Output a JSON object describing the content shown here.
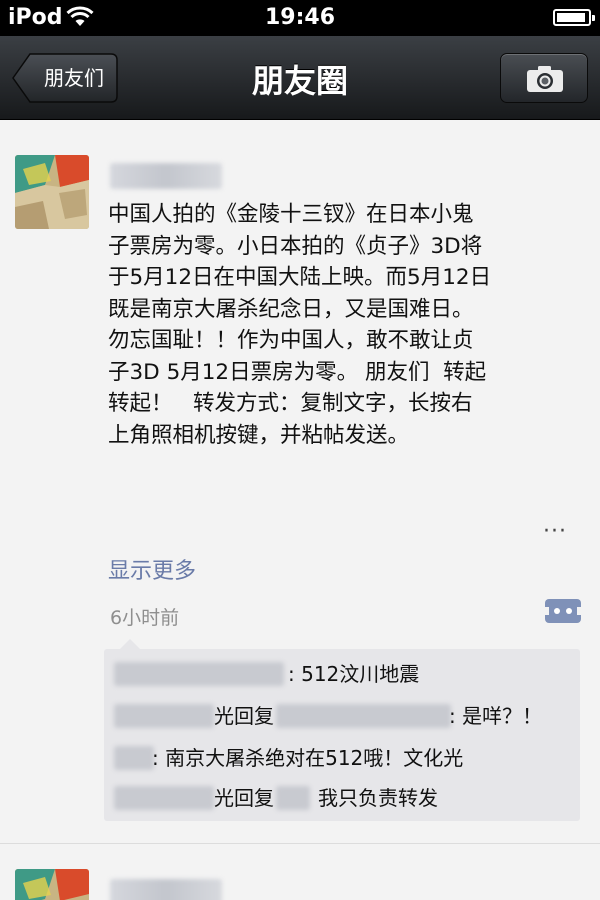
{
  "status_bar": {
    "carrier": "iPod",
    "time": "19:46"
  },
  "nav": {
    "back_label": "朋友们",
    "title": "朋友圈",
    "camera_icon": "camera-icon"
  },
  "post": {
    "lines": [
      "中国人拍的《金陵十三钗》在日本小鬼",
      "子票房为零。小日本拍的《贞子》3D将",
      "于5月12日在中国大陆上映。而5月12日",
      "既是南京大屠杀纪念日，又是国难日。",
      "勿忘国耻！！作为中国人，敢不敢让贞",
      "子3D 5月12日票房为零。 朋友们  转起",
      "转起！   转发方式：复制文字，长按右",
      "上角照相机按键，并粘帖发送。"
    ],
    "more_dots": "···",
    "show_more": "显示更多",
    "time": "6小时前"
  },
  "comments": [
    {
      "text": ": 512汶川地震"
    },
    {
      "reply_word": "光回复",
      "text": ": 是咩？！"
    },
    {
      "text": ": 南京大屠杀绝对在512哦！文化光"
    },
    {
      "reply_word": "光回复",
      "text": "我只负责转发"
    }
  ]
}
